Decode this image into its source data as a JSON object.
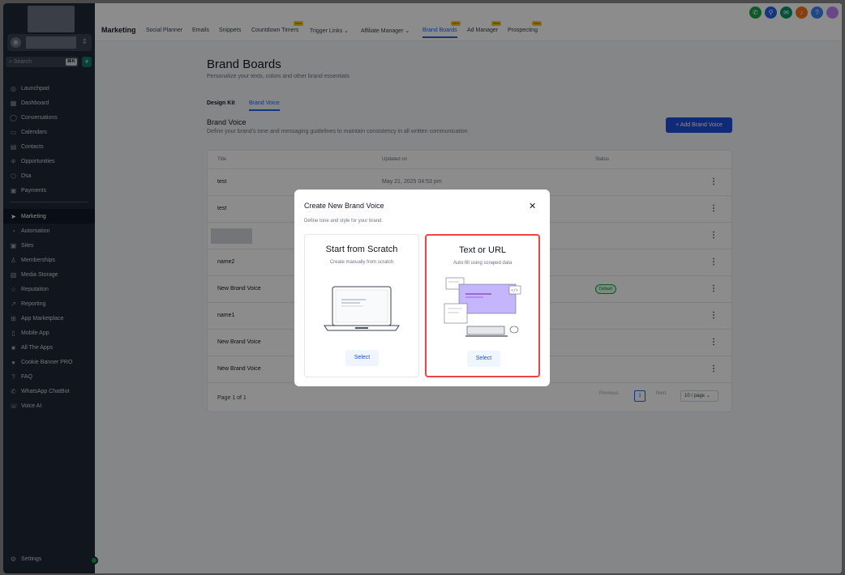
{
  "sidebar": {
    "search_placeholder": "Search",
    "search_shortcut": "⌘K",
    "items": [
      {
        "label": "Launchpad",
        "icon": "launchpad-icon"
      },
      {
        "label": "Dashboard",
        "icon": "dashboard-icon"
      },
      {
        "label": "Conversations",
        "icon": "chat-icon"
      },
      {
        "label": "Calendars",
        "icon": "calendar-icon"
      },
      {
        "label": "Contacts",
        "icon": "contacts-icon"
      },
      {
        "label": "Opportunities",
        "icon": "opportunities-icon"
      },
      {
        "label": "Dsa",
        "icon": "cube-icon"
      },
      {
        "label": "Payments",
        "icon": "payments-icon"
      },
      {
        "label": "Marketing",
        "icon": "send-icon"
      },
      {
        "label": "Automation",
        "icon": "automation-icon"
      },
      {
        "label": "Sites",
        "icon": "sites-icon"
      },
      {
        "label": "Memberships",
        "icon": "memberships-icon"
      },
      {
        "label": "Media Storage",
        "icon": "media-icon"
      },
      {
        "label": "Reputation",
        "icon": "star-icon"
      },
      {
        "label": "Reporting",
        "icon": "chart-icon"
      },
      {
        "label": "App Marketplace",
        "icon": "grid-icon"
      },
      {
        "label": "Mobile App",
        "icon": "mobile-icon"
      },
      {
        "label": "All The Apps",
        "icon": "apps-icon"
      },
      {
        "label": "Cookie Banner PRO",
        "icon": "cookie-icon"
      },
      {
        "label": "FAQ",
        "icon": "question-icon"
      },
      {
        "label": "WhatsApp ChatBot",
        "icon": "whatsapp-icon"
      },
      {
        "label": "Voice AI",
        "icon": "phone-icon"
      }
    ],
    "settings_label": "Settings"
  },
  "topbar": {
    "title": "Marketing",
    "tabs": [
      {
        "label": "Social Planner",
        "badge": ""
      },
      {
        "label": "Emails",
        "badge": ""
      },
      {
        "label": "Snippets",
        "badge": ""
      },
      {
        "label": "Countdown Timers",
        "badge": "New"
      },
      {
        "label": "Trigger Links ⌄",
        "badge": ""
      },
      {
        "label": "Affiliate Manager ⌄",
        "badge": ""
      },
      {
        "label": "Brand Boards",
        "badge": "New"
      },
      {
        "label": "Ad Manager",
        "badge": "Beta"
      },
      {
        "label": "Prospecting",
        "badge": "New"
      }
    ]
  },
  "page": {
    "title": "Brand Boards",
    "subtitle": "Personalize your texts, colors and other brand essentials",
    "subtabs": [
      "Design Kit",
      "Brand Voice"
    ],
    "section_title": "Brand Voice",
    "section_sub": "Define your brand's tone and messaging guidelines to maintain consistency in all written communication",
    "add_button": "+ Add Brand Voice"
  },
  "table": {
    "headers": [
      "Title",
      "Updated on",
      "Status"
    ],
    "rows": [
      {
        "title": "test",
        "updated": "May 21, 2025 04:53 pm",
        "status": ""
      },
      {
        "title": "test",
        "updated": "",
        "status": ""
      },
      {
        "title": "",
        "updated": "",
        "status": ""
      },
      {
        "title": "name2",
        "updated": "",
        "status": ""
      },
      {
        "title": "New Brand Voice",
        "updated": "",
        "status": "Default"
      },
      {
        "title": "name1",
        "updated": "",
        "status": ""
      },
      {
        "title": "New Brand Voice",
        "updated": "",
        "status": ""
      },
      {
        "title": "New Brand Voice",
        "updated": "",
        "status": ""
      }
    ],
    "footer": "Page 1 of 1",
    "prev": "Previous",
    "current_page": "1",
    "next": "Next",
    "page_size": "10 / page ⌄"
  },
  "modal": {
    "title": "Create New Brand Voice",
    "subtitle": "Define tone and style for your brand.",
    "options": [
      {
        "title": "Start from Scratch",
        "sub": "Create manually from scratch",
        "button": "Select"
      },
      {
        "title": "Text or URL",
        "sub": "Auto-fill using scraped data",
        "button": "Select"
      }
    ]
  },
  "colors": {
    "accent": "#2563eb",
    "sidebar_bg": "#1f2937",
    "selected_border": "#ef4444"
  }
}
